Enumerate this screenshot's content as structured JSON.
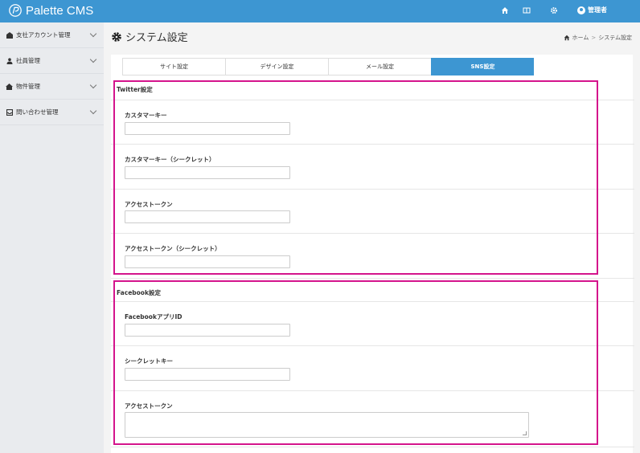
{
  "app": {
    "title": "Palette CMS"
  },
  "topbar": {
    "icons": [
      "home-icon",
      "book-icon",
      "gear-icon"
    ],
    "user_label": "管理者"
  },
  "sidebar": {
    "items": [
      {
        "label": "支社アカウント管理",
        "icon": "building-icon"
      },
      {
        "label": "社員管理",
        "icon": "person-icon"
      },
      {
        "label": "物件管理",
        "icon": "house-icon"
      },
      {
        "label": "問い合わせ管理",
        "icon": "inbox-icon"
      }
    ]
  },
  "page": {
    "title": "システム設定",
    "breadcrumb": {
      "home": "ホーム",
      "separator": ">",
      "current": "システム設定"
    }
  },
  "tabs": [
    {
      "label": "サイト設定",
      "active": false
    },
    {
      "label": "デザイン設定",
      "active": false
    },
    {
      "label": "メール設定",
      "active": false
    },
    {
      "label": "SNS設定",
      "active": true
    }
  ],
  "twitter": {
    "title": "Twitter設定",
    "fields": [
      {
        "label": "カスタマーキー",
        "value": ""
      },
      {
        "label": "カスタマーキー（シークレット）",
        "value": ""
      },
      {
        "label": "アクセストークン",
        "value": ""
      },
      {
        "label": "アクセストークン（シークレット）",
        "value": ""
      }
    ]
  },
  "facebook": {
    "title": "Facebook設定",
    "fields": [
      {
        "label": "FacebookアプリID",
        "value": ""
      },
      {
        "label": "シークレットキー",
        "value": ""
      },
      {
        "label": "アクセストークン",
        "value": ""
      }
    ]
  },
  "colors": {
    "accent": "#3d96d2",
    "highlight": "#d4148c",
    "sidebar": "#e9ebee"
  }
}
